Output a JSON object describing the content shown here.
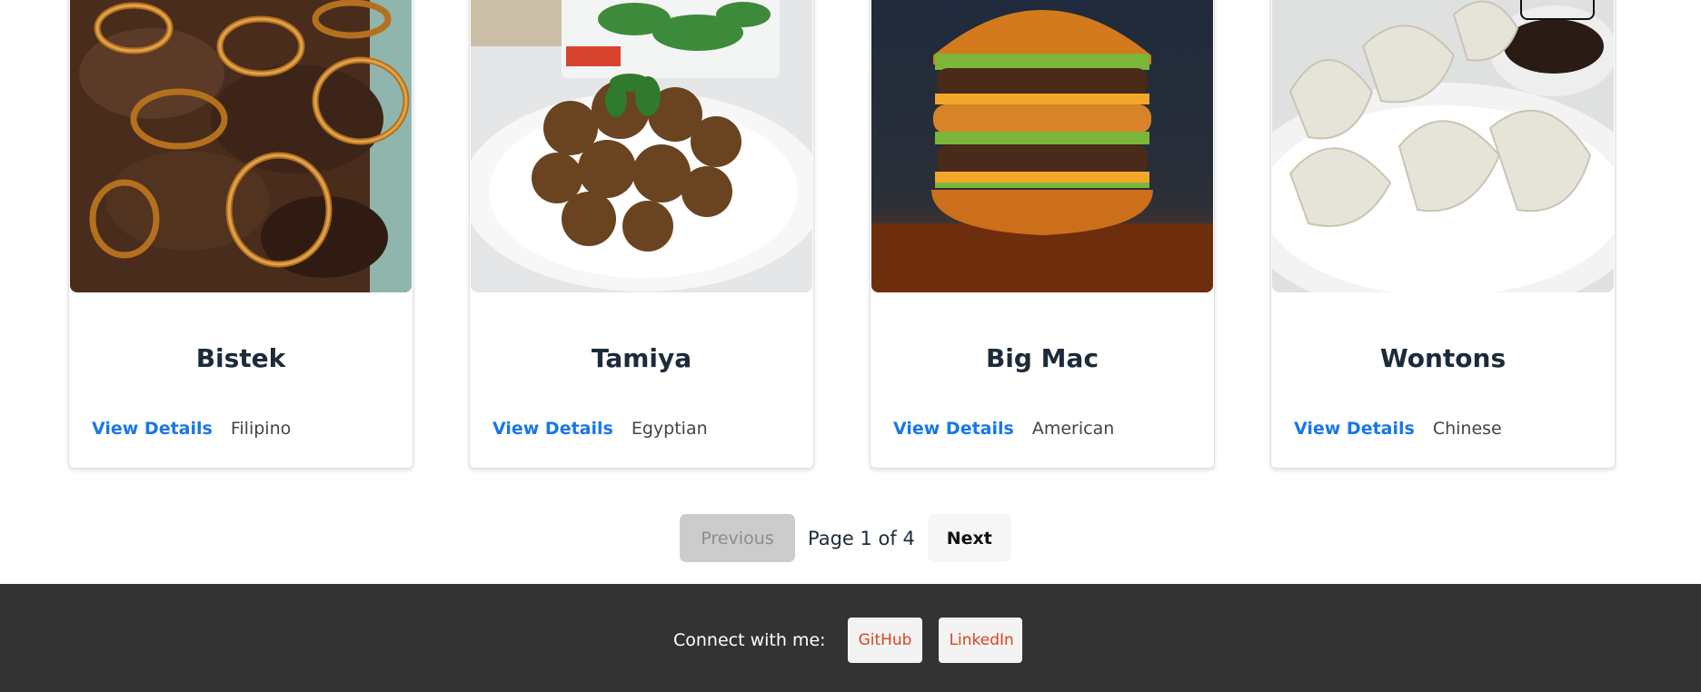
{
  "recipes": [
    {
      "title": "Bistek",
      "link_label": "View Details",
      "cuisine": "Filipino",
      "image": "bistek-photo"
    },
    {
      "title": "Tamiya",
      "link_label": "View Details",
      "cuisine": "Egyptian",
      "image": "tamiya-photo"
    },
    {
      "title": "Big Mac",
      "link_label": "View Details",
      "cuisine": "American",
      "image": "big-mac-photo"
    },
    {
      "title": "Wontons",
      "link_label": "View Details",
      "cuisine": "Chinese",
      "image": "wontons-photo"
    }
  ],
  "pagination": {
    "previous_label": "Previous",
    "page_info": "Page 1 of 4",
    "next_label": "Next",
    "current_page": 1,
    "total_pages": 4
  },
  "footer": {
    "connect_label": "Connect with me:",
    "github_label": "GitHub",
    "linkedin_label": "LinkedIn"
  },
  "colors": {
    "link": "#1877e8",
    "title": "#1c2b3a",
    "footer_bg": "#333333",
    "social_text": "#d9441e",
    "disabled_bg": "#cccccc"
  }
}
